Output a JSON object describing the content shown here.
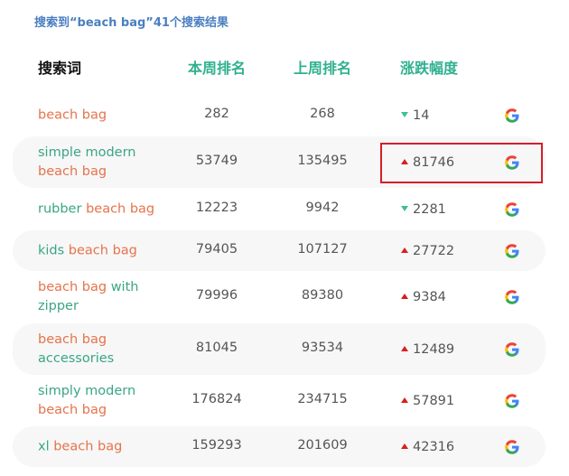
{
  "summary": "搜索到“beach bag”41个搜索结果",
  "headers": {
    "keyword": "搜索词",
    "this_week": "本周排名",
    "last_week": "上周排名",
    "change": "涨跌幅度"
  },
  "colors": {
    "highlight": "#e5734b",
    "keyword_plain": "#3aa586",
    "header": "#2fb08f",
    "up": "#d71f1f",
    "down": "#3dbf95",
    "summary": "#4a7fc1",
    "box": "#d21f2a"
  },
  "rows": [
    {
      "parts": [
        {
          "t": "beach bag",
          "hl": true
        }
      ],
      "week": "282",
      "last": "268",
      "dir": "down",
      "change": "14",
      "icon": "google-icon"
    },
    {
      "parts": [
        {
          "t": "simple modern",
          "hl": false
        },
        {
          "t": "beach bag",
          "hl": true
        }
      ],
      "week": "53749",
      "last": "135495",
      "dir": "up",
      "change": "81746",
      "icon": "google-icon"
    },
    {
      "parts": [
        {
          "t": "rubber ",
          "hl": false
        },
        {
          "t": "beach bag",
          "hl": true
        }
      ],
      "week": "12223",
      "last": "9942",
      "dir": "down",
      "change": "2281",
      "icon": "google-icon"
    },
    {
      "parts": [
        {
          "t": "kids ",
          "hl": false
        },
        {
          "t": "beach bag",
          "hl": true
        }
      ],
      "week": "79405",
      "last": "107127",
      "dir": "up",
      "change": "27722",
      "icon": "google-icon"
    },
    {
      "parts": [
        {
          "t": "beach bag",
          "hl": true
        },
        {
          "t": " with zipper",
          "hl": false
        }
      ],
      "week": "79996",
      "last": "89380",
      "dir": "up",
      "change": "9384",
      "icon": "google-icon"
    },
    {
      "parts": [
        {
          "t": "beach bag",
          "hl": true
        },
        {
          "t": "accessories",
          "hl": false
        }
      ],
      "week": "81045",
      "last": "93534",
      "dir": "up",
      "change": "12489",
      "icon": "google-icon"
    },
    {
      "parts": [
        {
          "t": "simply modern",
          "hl": false
        },
        {
          "t": "beach bag",
          "hl": true
        }
      ],
      "week": "176824",
      "last": "234715",
      "dir": "up",
      "change": "57891",
      "icon": "google-icon"
    },
    {
      "parts": [
        {
          "t": "xl ",
          "hl": false
        },
        {
          "t": "beach bag",
          "hl": true
        }
      ],
      "week": "159293",
      "last": "201609",
      "dir": "up",
      "change": "42316",
      "icon": "google-icon"
    }
  ]
}
